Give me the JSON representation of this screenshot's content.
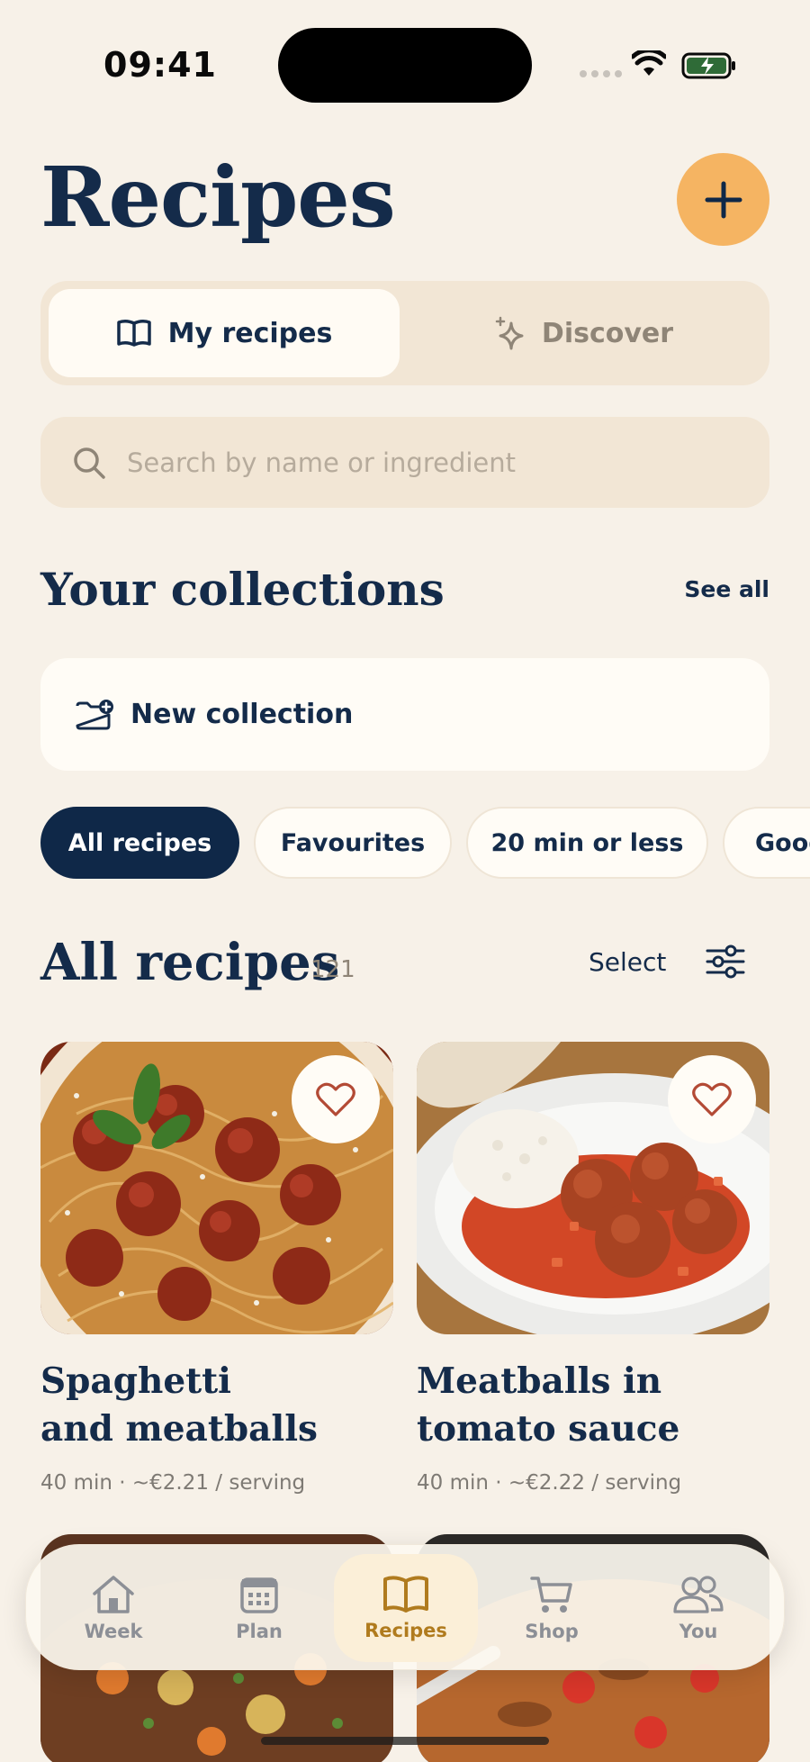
{
  "status_bar": {
    "time": "09:41"
  },
  "header": {
    "title": "Recipes",
    "add_icon": "plus-icon"
  },
  "tabs": [
    {
      "label": "My recipes",
      "icon": "open-book-icon",
      "active": true
    },
    {
      "label": "Discover",
      "icon": "sparkle-icon",
      "active": false
    }
  ],
  "search": {
    "placeholder": "Search by name or ingredient",
    "icon": "search-icon"
  },
  "collections": {
    "title": "Your collections",
    "see_all": "See all",
    "new_collection_label": "New collection",
    "new_collection_icon": "folder-plus-icon"
  },
  "chips": [
    {
      "label": "All recipes",
      "active": true
    },
    {
      "label": "Favourites",
      "active": false
    },
    {
      "label": "20 min or less",
      "active": false
    },
    {
      "label": "Good",
      "active": false
    }
  ],
  "all_recipes": {
    "title": "All recipes",
    "count": "121",
    "select_label": "Select",
    "filter_icon": "sliders-icon"
  },
  "recipes": [
    {
      "title_line1": "Spaghetti",
      "title_line2": "and meatballs",
      "meta": "40 min · ~€2.21 / serving",
      "favourite_icon": "heart-icon"
    },
    {
      "title_line1": "Meatballs in",
      "title_line2": "tomato sauce",
      "meta": "40 min · ~€2.22 / serving",
      "favourite_icon": "heart-icon"
    }
  ],
  "bottom_nav": [
    {
      "label": "Week",
      "icon": "home-icon",
      "active": false
    },
    {
      "label": "Plan",
      "icon": "calendar-icon",
      "active": false
    },
    {
      "label": "Recipes",
      "icon": "open-book-icon",
      "active": true
    },
    {
      "label": "Shop",
      "icon": "cart-icon",
      "active": false
    },
    {
      "label": "You",
      "icon": "users-icon",
      "active": false
    }
  ],
  "colors": {
    "background": "#F7F1E8",
    "primary_navy": "#142B4A",
    "accent_orange": "#F5B462",
    "active_nav": "#B07B1E"
  }
}
